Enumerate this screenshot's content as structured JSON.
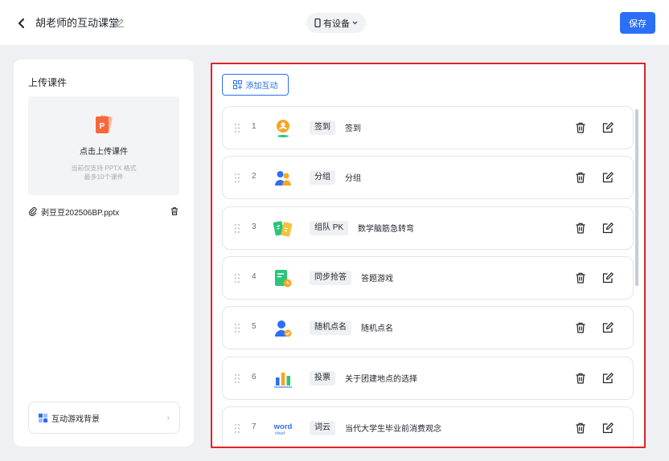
{
  "header": {
    "title": "胡老师的互动课堂",
    "device_label": "有设备",
    "save_label": "保存"
  },
  "left": {
    "section_title": "上传课件",
    "upload_label": "点击上传课件",
    "upload_hint_1": "当前仅支持 PPTX 格式",
    "upload_hint_2": "最多10个课件",
    "file_name": "剥豆豆202506BP.pptx",
    "background_label": "互动游戏背景"
  },
  "right": {
    "add_label": "添加互动",
    "items": [
      {
        "num": "1",
        "tag": "签到",
        "desc": "签到",
        "icon": "checkin-icon"
      },
      {
        "num": "2",
        "tag": "分组",
        "desc": "分组",
        "icon": "group-icon"
      },
      {
        "num": "3",
        "tag": "组队 PK",
        "desc": "数学脑筋急转弯",
        "icon": "team-pk-icon"
      },
      {
        "num": "4",
        "tag": "同步抢答",
        "desc": "答题游戏",
        "icon": "quiz-icon"
      },
      {
        "num": "5",
        "tag": "随机点名",
        "desc": "随机点名",
        "icon": "random-pick-icon"
      },
      {
        "num": "6",
        "tag": "投票",
        "desc": "关于团建地点的选择",
        "icon": "vote-icon"
      },
      {
        "num": "7",
        "tag": "词云",
        "desc": "当代大学生毕业前消费观念",
        "icon": "word-cloud-icon"
      }
    ],
    "word_icon_text": "word",
    "word_icon_sub": "cloud"
  },
  "colors": {
    "accent": "#2b6ff6",
    "highlight_border": "#e02424"
  }
}
